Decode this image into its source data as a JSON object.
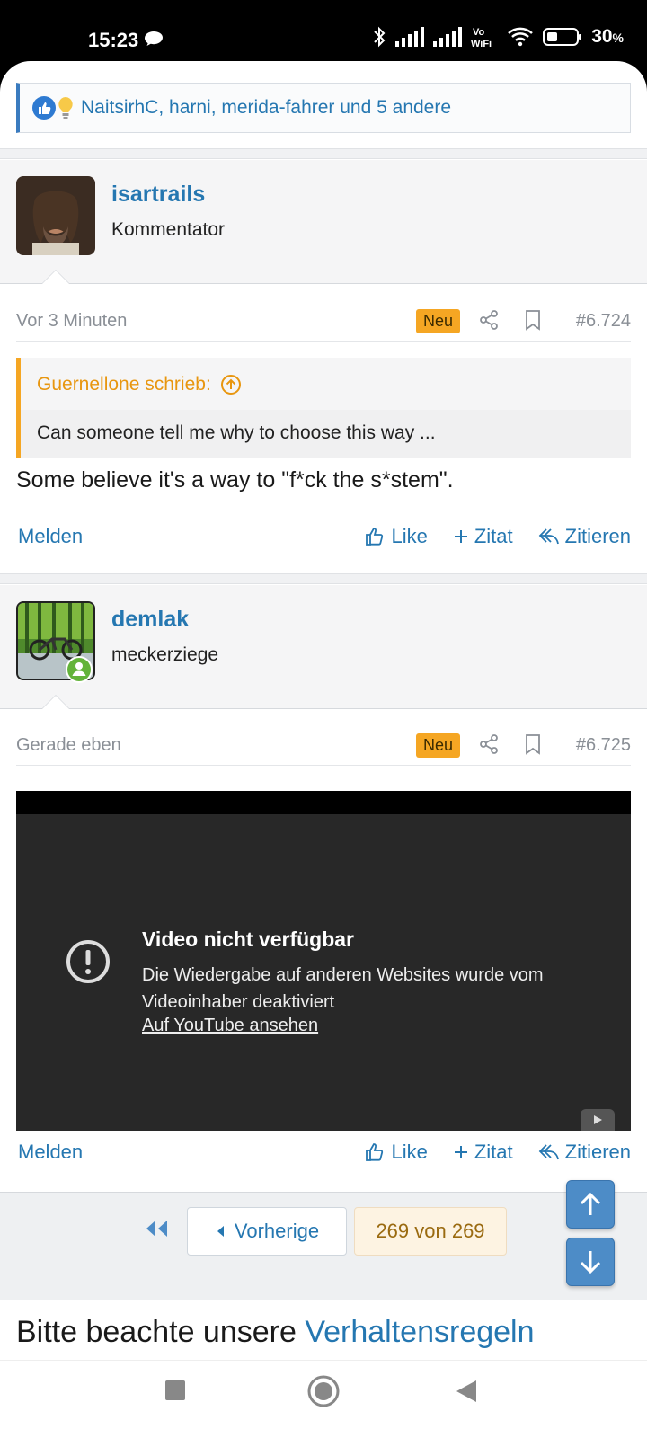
{
  "status_bar": {
    "time": "15:23",
    "battery": "30",
    "battery_unit": "%"
  },
  "reactions": {
    "text": "NaitsirhC, harni, merida-fahrer und 5 andere"
  },
  "posts": [
    {
      "username": "isartrails",
      "user_title": "Kommentator",
      "time": "Vor 3 Minuten",
      "badge": "Neu",
      "number": "#6.724",
      "quote": {
        "author": "Guernellone schrieb:",
        "text": "Can someone tell me why to choose this way ..."
      },
      "body": "Some believe it's a way to \"f*ck the s*stem\"."
    },
    {
      "username": "demlak",
      "user_title": "meckerziege",
      "time": "Gerade eben",
      "badge": "Neu",
      "number": "#6.725",
      "video": {
        "title": "Video nicht verfügbar",
        "description": "Die Wiedergabe auf anderen Websites wurde vom Videoinhaber deaktiviert",
        "link": "Auf YouTube ansehen"
      }
    }
  ],
  "actions": {
    "report": "Melden",
    "like": "Like",
    "add_quote": "Zitat",
    "reply": "Zitieren"
  },
  "pager": {
    "prev": "Vorherige",
    "pages": "269 von 269"
  },
  "footer": {
    "text": "Bitte beachte unsere ",
    "link": "Verhaltensregeln"
  },
  "colors": {
    "accent": "#2577b1",
    "badge": "#f5a623",
    "quote_border": "#f5a623"
  }
}
